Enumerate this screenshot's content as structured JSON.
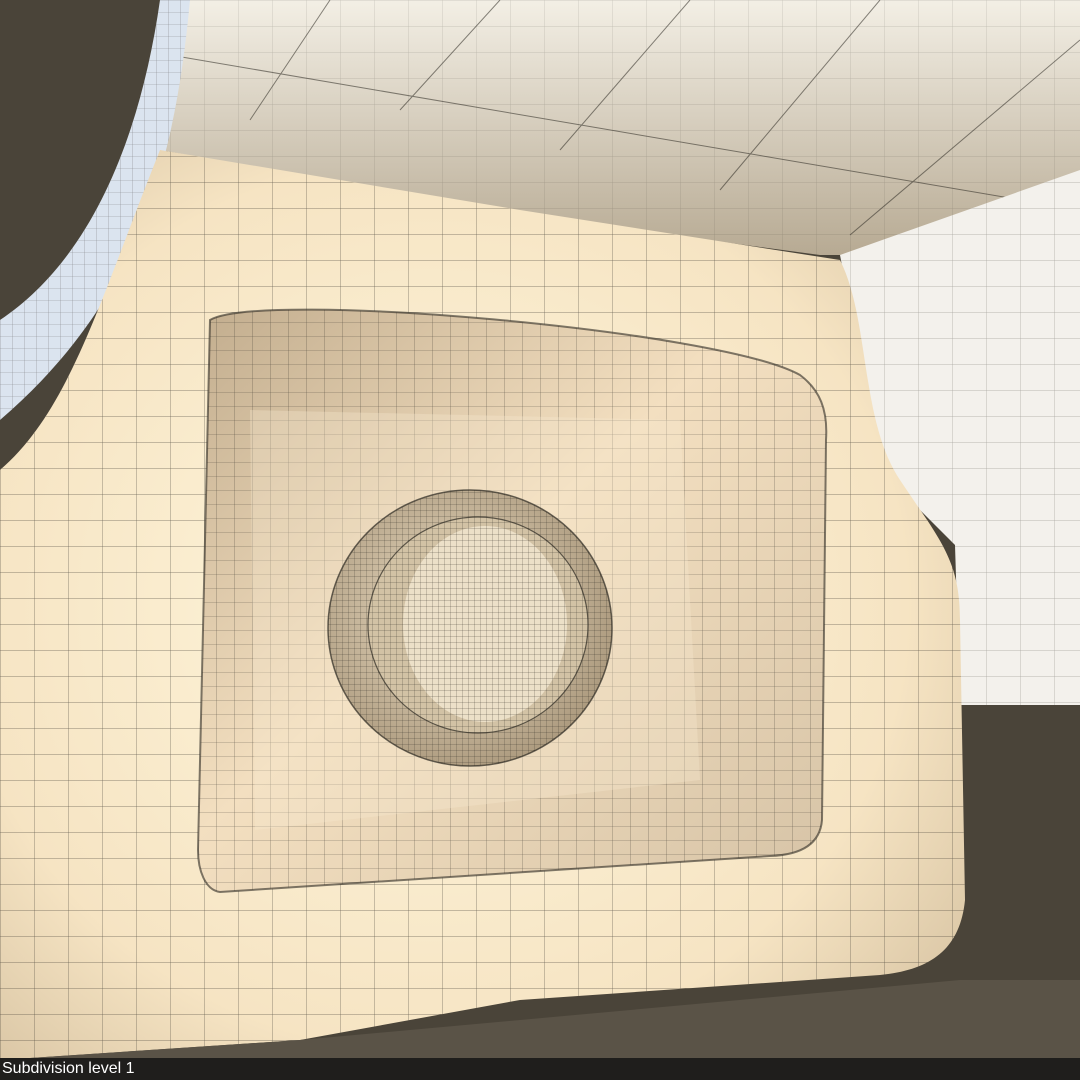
{
  "viewport": {
    "status_label": "Subdivision level 1"
  },
  "colors": {
    "background": "#4a4439",
    "surface_light": "#fff6dc",
    "surface_warm": "#f1dcbc",
    "surface_shadow": "#c9b697",
    "wireframe": "#2b2821",
    "status_bar": "#1f1e1c",
    "status_text": "#ffffff"
  },
  "icons": {
    "model": "wireframe-mesh-icon"
  }
}
